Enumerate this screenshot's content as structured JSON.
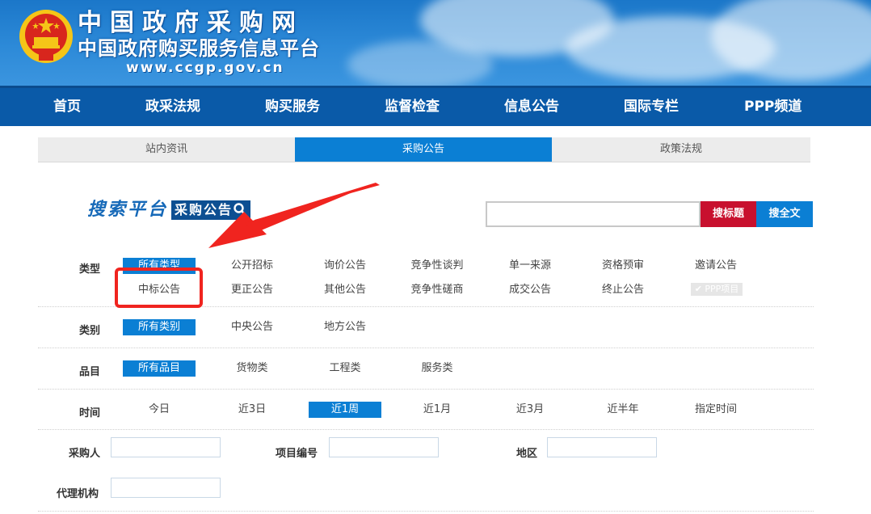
{
  "header": {
    "title": "中国政府采购网",
    "subtitle": "中国政府购买服务信息平台",
    "url": "www.ccgp.gov.cn"
  },
  "nav": [
    {
      "label": "首页"
    },
    {
      "label": "政采法规"
    },
    {
      "label": "购买服务"
    },
    {
      "label": "监督检查"
    },
    {
      "label": "信息公告"
    },
    {
      "label": "国际专栏"
    },
    {
      "label": "PPP频道"
    }
  ],
  "subtabs": [
    {
      "label": "站内资讯",
      "active": false
    },
    {
      "label": "采购公告",
      "active": true
    },
    {
      "label": "政策法规",
      "active": false
    }
  ],
  "search": {
    "platform_label": "搜索平台",
    "platform_tag": "采购公告",
    "value": "",
    "btn_title": "搜标题",
    "btn_fulltext": "搜全文"
  },
  "filters": {
    "type": {
      "label": "类型",
      "options": [
        "所有类型",
        "公开招标",
        "询价公告",
        "竞争性谈判",
        "单一来源",
        "资格预审",
        "邀请公告",
        "中标公告",
        "更正公告",
        "其他公告",
        "竞争性磋商",
        "成交公告",
        "终止公告",
        "PPP项目"
      ],
      "selected": "所有类型"
    },
    "category": {
      "label": "类别",
      "options": [
        "所有类别",
        "中央公告",
        "地方公告"
      ],
      "selected": "所有类别"
    },
    "item": {
      "label": "品目",
      "options": [
        "所有品目",
        "货物类",
        "工程类",
        "服务类"
      ],
      "selected": "所有品目"
    },
    "time": {
      "label": "时间",
      "options": [
        "今日",
        "近3日",
        "近1周",
        "近1月",
        "近3月",
        "近半年",
        "指定时间"
      ],
      "selected": "近1周"
    }
  },
  "fields": {
    "purchaser": {
      "label": "采购人",
      "value": ""
    },
    "project_no": {
      "label": "项目编号",
      "value": ""
    },
    "region": {
      "label": "地区",
      "value": ""
    },
    "agency": {
      "label": "代理机构",
      "value": ""
    }
  },
  "colors": {
    "nav_bg": "#0a5aa8",
    "accent_blue": "#0b7fd4",
    "accent_red": "#c8102e",
    "annotation_red": "#f0241f"
  },
  "annotation": {
    "highlighted_option": "中标公告"
  }
}
